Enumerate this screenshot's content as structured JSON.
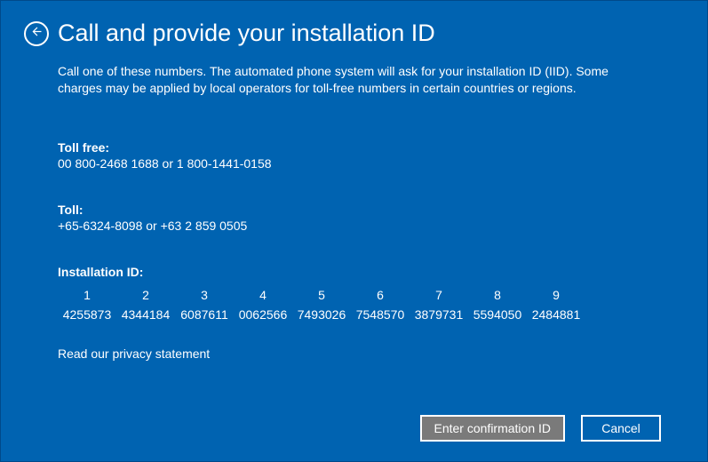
{
  "header": {
    "title": "Call and provide your installation ID"
  },
  "description": "Call one of these numbers. The automated phone system will ask for your installation ID (IID). Some charges may be applied by local operators for toll-free numbers in certain countries or regions.",
  "toll_free": {
    "label": "Toll free:",
    "value": "00 800-2468 1688 or 1 800-1441-0158"
  },
  "toll": {
    "label": "Toll:",
    "value": "+65-6324-8098 or +63 2 859 0505"
  },
  "installation_id": {
    "label": "Installation ID:",
    "headers": [
      "1",
      "2",
      "3",
      "4",
      "5",
      "6",
      "7",
      "8",
      "9"
    ],
    "groups": [
      "4255873",
      "4344184",
      "6087611",
      "0062566",
      "7493026",
      "7548570",
      "3879731",
      "5594050",
      "2484881"
    ]
  },
  "privacy_link": "Read our privacy statement",
  "buttons": {
    "confirm": "Enter confirmation ID",
    "cancel": "Cancel"
  }
}
